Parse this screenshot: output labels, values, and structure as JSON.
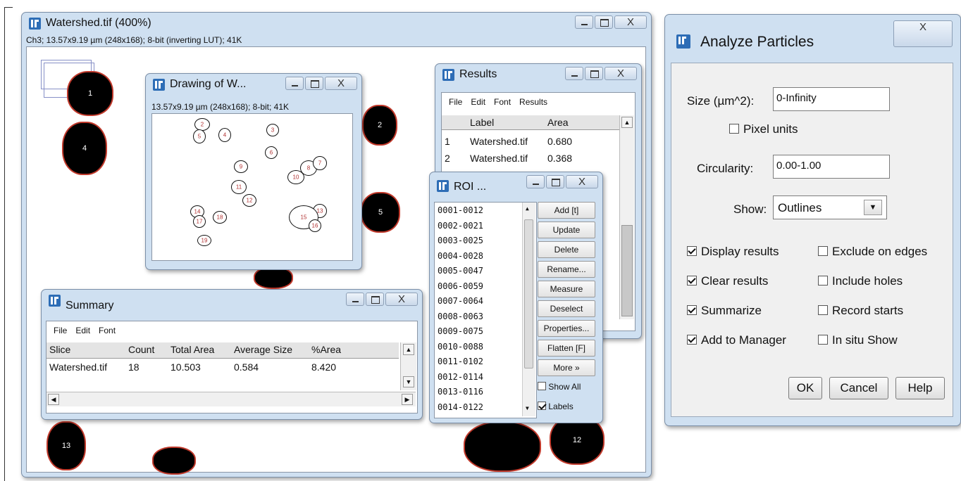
{
  "main_window": {
    "title": "Watershed.tif (400%)",
    "info": "Ch3; 13.57x9.19 µm (248x168); 8-bit (inverting LUT); 41K",
    "particle_labels": [
      "1",
      "4",
      "2",
      "5",
      "13",
      "12"
    ]
  },
  "drawing_window": {
    "title": "Drawing of W...",
    "info": "13.57x9.19 µm (248x168); 8-bit; 41K",
    "outline_labels": [
      "2",
      "5",
      "4",
      "3",
      "6",
      "9",
      "8",
      "7",
      "10",
      "11",
      "12",
      "14",
      "17",
      "18",
      "16",
      "13",
      "15",
      "19"
    ]
  },
  "results_window": {
    "title": "Results",
    "menu": [
      "File",
      "Edit",
      "Font",
      "Results"
    ],
    "columns": [
      "Label",
      "Area"
    ],
    "rows": [
      {
        "index": "1",
        "label": "Watershed.tif",
        "area": "0.680"
      },
      {
        "index": "2",
        "label": "Watershed.tif",
        "area": "0.368"
      }
    ]
  },
  "roi_window": {
    "title": "ROI ...",
    "items": [
      "0001-0012",
      "0002-0021",
      "0003-0025",
      "0004-0028",
      "0005-0047",
      "0006-0059",
      "0007-0064",
      "0008-0063",
      "0009-0075",
      "0010-0088",
      "0011-0102",
      "0012-0114",
      "0013-0116",
      "0014-0122"
    ],
    "buttons": [
      "Add [t]",
      "Update",
      "Delete",
      "Rename...",
      "Measure",
      "Deselect",
      "Properties...",
      "Flatten [F]",
      "More »"
    ],
    "show_all_label": "Show All",
    "show_all_checked": false,
    "labels_label": "Labels",
    "labels_checked": true
  },
  "summary_window": {
    "title": "Summary",
    "menu": [
      "File",
      "Edit",
      "Font"
    ],
    "columns": [
      "Slice",
      "Count",
      "Total Area",
      "Average Size",
      "%Area"
    ],
    "row": [
      "Watershed.tif",
      "18",
      "10.503",
      "0.584",
      "8.420"
    ]
  },
  "analyze_dialog": {
    "title": "Analyze Particles",
    "size_label": "Size (µm^2):",
    "size_value": "0-Infinity",
    "pixel_units_label": "Pixel units",
    "pixel_units_checked": false,
    "circularity_label": "Circularity:",
    "circularity_value": "0.00-1.00",
    "show_label": "Show:",
    "show_value": "Outlines",
    "options": [
      {
        "label": "Display results",
        "checked": true
      },
      {
        "label": "Exclude on edges",
        "checked": false
      },
      {
        "label": "Clear results",
        "checked": true
      },
      {
        "label": "Include holes",
        "checked": false
      },
      {
        "label": "Summarize",
        "checked": true
      },
      {
        "label": "Record starts",
        "checked": false
      },
      {
        "label": "Add to Manager",
        "checked": true
      },
      {
        "label": "In situ Show",
        "checked": false
      }
    ],
    "ok_label": "OK",
    "cancel_label": "Cancel",
    "help_label": "Help"
  },
  "colors": {
    "window_frame": "#cfe0f1",
    "particle_outline": "#c0392b",
    "ij_icon": "#2d6db6"
  }
}
